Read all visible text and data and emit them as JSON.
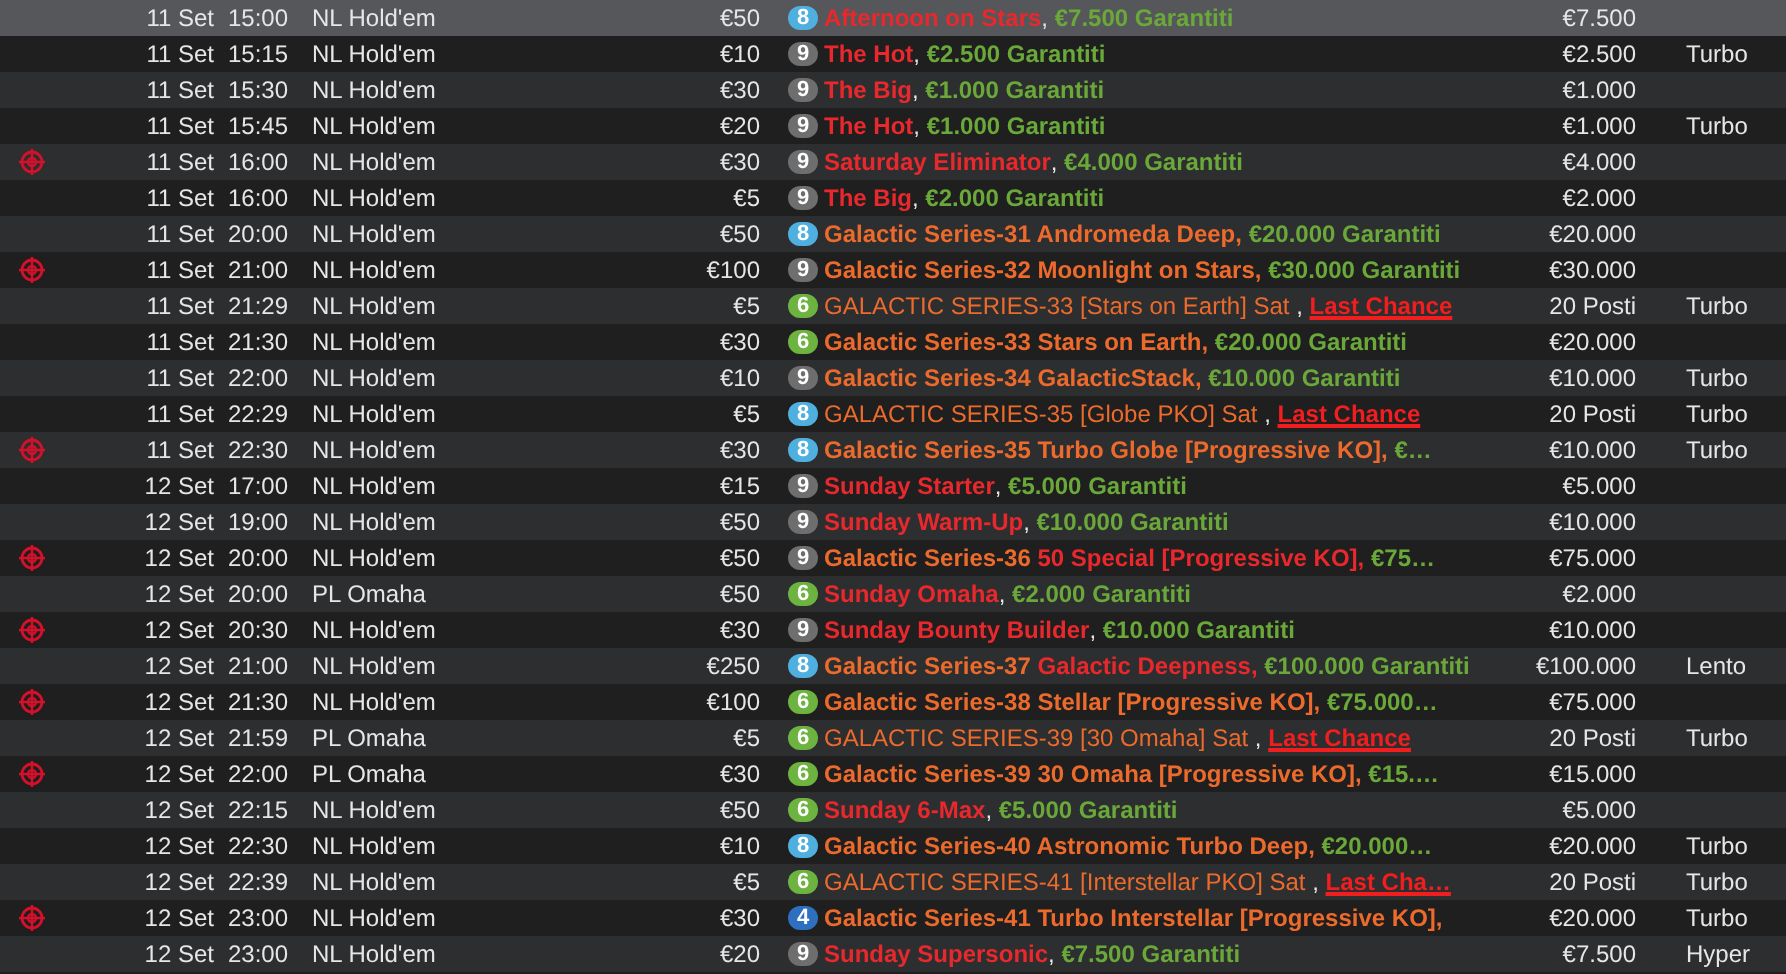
{
  "rows": [
    {
      "selected": true,
      "target": false,
      "date": "11 Set",
      "time": "15:00",
      "game": "NL Hold'em",
      "buyin": "€50",
      "badge": {
        "text": "8",
        "color": "#4fb0e0"
      },
      "name": [
        {
          "kind": "event",
          "text": "Afternoon on Stars"
        },
        {
          "kind": "sep",
          "text": ", "
        },
        {
          "kind": "prize",
          "text": "€7.500 Garantiti"
        }
      ],
      "guarantee": "€7.500"
    },
    {
      "selected": false,
      "target": false,
      "date": "11 Set",
      "time": "15:15",
      "game": "NL Hold'em",
      "buyin": "€10",
      "badge": {
        "text": "9",
        "color": "#6e6e6e"
      },
      "name": [
        {
          "kind": "event",
          "text": "The Hot"
        },
        {
          "kind": "sep",
          "text": ", "
        },
        {
          "kind": "prize",
          "text": "€2.500 Garantiti"
        }
      ],
      "guarantee": "€2.500",
      "speed": "Turbo"
    },
    {
      "selected": false,
      "target": false,
      "date": "11 Set",
      "time": "15:30",
      "game": "NL Hold'em",
      "buyin": "€30",
      "badge": {
        "text": "9",
        "color": "#6e6e6e"
      },
      "name": [
        {
          "kind": "event",
          "text": "The Big"
        },
        {
          "kind": "sep",
          "text": ", "
        },
        {
          "kind": "prize",
          "text": "€1.000 Garantiti"
        }
      ],
      "guarantee": "€1.000"
    },
    {
      "selected": false,
      "target": false,
      "date": "11 Set",
      "time": "15:45",
      "game": "NL Hold'em",
      "buyin": "€20",
      "badge": {
        "text": "9",
        "color": "#6e6e6e"
      },
      "name": [
        {
          "kind": "event",
          "text": "The Hot"
        },
        {
          "kind": "sep",
          "text": ", "
        },
        {
          "kind": "prize",
          "text": "€1.000 Garantiti"
        }
      ],
      "guarantee": "€1.000",
      "speed": "Turbo"
    },
    {
      "selected": false,
      "target": true,
      "date": "11 Set",
      "time": "16:00",
      "game": "NL Hold'em",
      "buyin": "€30",
      "badge": {
        "text": "9",
        "color": "#6e6e6e"
      },
      "name": [
        {
          "kind": "event",
          "text": "Saturday Eliminator"
        },
        {
          "kind": "sep",
          "text": ", "
        },
        {
          "kind": "prize",
          "text": "€4.000 Garantiti"
        }
      ],
      "guarantee": "€4.000"
    },
    {
      "selected": false,
      "target": false,
      "date": "11 Set",
      "time": "16:00",
      "game": "NL Hold'em",
      "buyin": "€5",
      "badge": {
        "text": "9",
        "color": "#6e6e6e"
      },
      "name": [
        {
          "kind": "event",
          "text": "The Big"
        },
        {
          "kind": "sep",
          "text": ", "
        },
        {
          "kind": "prize",
          "text": "€2.000 Garantiti"
        }
      ],
      "guarantee": "€2.000"
    },
    {
      "selected": false,
      "target": false,
      "date": "11 Set",
      "time": "20:00",
      "game": "NL Hold'em",
      "buyin": "€50",
      "badge": {
        "text": "8",
        "color": "#4fb0e0"
      },
      "name": [
        {
          "kind": "series",
          "text": "Galactic Series-31 Andromeda Deep,"
        },
        {
          "kind": "prize",
          "text": " €20.000 Garantiti"
        }
      ],
      "guarantee": "€20.000"
    },
    {
      "selected": false,
      "target": true,
      "date": "11 Set",
      "time": "21:00",
      "game": "NL Hold'em",
      "buyin": "€100",
      "badge": {
        "text": "9",
        "color": "#6e6e6e"
      },
      "name": [
        {
          "kind": "series",
          "text": "Galactic Series-32 Moonlight on Stars,"
        },
        {
          "kind": "prize",
          "text": " €30.000 Garantiti"
        }
      ],
      "guarantee": "€30.000"
    },
    {
      "selected": false,
      "target": false,
      "date": "11 Set",
      "time": "21:29",
      "game": "NL Hold'em",
      "buyin": "€5",
      "badge": {
        "text": "6",
        "color": "#6db33f"
      },
      "name": [
        {
          "kind": "sat",
          "text": "GALACTIC SERIES-33 [Stars on Earth] Sat"
        },
        {
          "kind": "sep",
          "text": " , "
        },
        {
          "kind": "chance",
          "text": "Last Chance"
        }
      ],
      "guarantee": "20 Posti",
      "speed": "Turbo"
    },
    {
      "selected": false,
      "target": false,
      "date": "11 Set",
      "time": "21:30",
      "game": "NL Hold'em",
      "buyin": "€30",
      "badge": {
        "text": "6",
        "color": "#6db33f"
      },
      "name": [
        {
          "kind": "series",
          "text": "Galactic Series-33 Stars on Earth,"
        },
        {
          "kind": "prize",
          "text": " €20.000 Garantiti"
        }
      ],
      "guarantee": "€20.000"
    },
    {
      "selected": false,
      "target": false,
      "date": "11 Set",
      "time": "22:00",
      "game": "NL Hold'em",
      "buyin": "€10",
      "badge": {
        "text": "9",
        "color": "#6e6e6e"
      },
      "name": [
        {
          "kind": "series",
          "text": "Galactic Series-34 GalacticStack,"
        },
        {
          "kind": "prize",
          "text": " €10.000 Garantiti"
        }
      ],
      "guarantee": "€10.000",
      "speed": "Turbo"
    },
    {
      "selected": false,
      "target": false,
      "date": "11 Set",
      "time": "22:29",
      "game": "NL Hold'em",
      "buyin": "€5",
      "badge": {
        "text": "8",
        "color": "#4fb0e0"
      },
      "name": [
        {
          "kind": "sat",
          "text": "GALACTIC SERIES-35 [Globe PKO] Sat"
        },
        {
          "kind": "sep",
          "text": " , "
        },
        {
          "kind": "chance",
          "text": "Last Chance"
        }
      ],
      "guarantee": "20 Posti",
      "speed": "Turbo"
    },
    {
      "selected": false,
      "target": true,
      "date": "11 Set",
      "time": "22:30",
      "game": "NL Hold'em",
      "buyin": "€30",
      "badge": {
        "text": "8",
        "color": "#4fb0e0"
      },
      "name": [
        {
          "kind": "series",
          "text": "Galactic Series-35 Turbo Globe [Progressive KO],"
        },
        {
          "kind": "prize",
          "text": " €…"
        }
      ],
      "guarantee": "€10.000",
      "speed": "Turbo"
    },
    {
      "selected": false,
      "target": false,
      "date": "12 Set",
      "time": "17:00",
      "game": "NL Hold'em",
      "buyin": "€15",
      "badge": {
        "text": "9",
        "color": "#6e6e6e"
      },
      "name": [
        {
          "kind": "event",
          "text": "Sunday Starter"
        },
        {
          "kind": "sep",
          "text": ", "
        },
        {
          "kind": "prize",
          "text": "€5.000 Garantiti"
        }
      ],
      "guarantee": "€5.000"
    },
    {
      "selected": false,
      "target": false,
      "date": "12 Set",
      "time": "19:00",
      "game": "NL Hold'em",
      "buyin": "€50",
      "badge": {
        "text": "9",
        "color": "#6e6e6e"
      },
      "name": [
        {
          "kind": "event",
          "text": "Sunday Warm-Up"
        },
        {
          "kind": "sep",
          "text": ", "
        },
        {
          "kind": "prize",
          "text": "€10.000 Garantiti"
        }
      ],
      "guarantee": "€10.000"
    },
    {
      "selected": false,
      "target": true,
      "date": "12 Set",
      "time": "20:00",
      "game": "NL Hold'em",
      "buyin": "€50",
      "badge": {
        "text": "9",
        "color": "#6e6e6e"
      },
      "name": [
        {
          "kind": "series",
          "text": "Galactic Series-36 "
        },
        {
          "kind": "event",
          "text": "50 Special [Progressive KO],"
        },
        {
          "kind": "prize",
          "text": " €75…"
        }
      ],
      "guarantee": "€75.000"
    },
    {
      "selected": false,
      "target": false,
      "date": "12 Set",
      "time": "20:00",
      "game": "PL Omaha",
      "buyin": "€50",
      "badge": {
        "text": "6",
        "color": "#6db33f"
      },
      "name": [
        {
          "kind": "event",
          "text": "Sunday Omaha"
        },
        {
          "kind": "sep",
          "text": ", "
        },
        {
          "kind": "prize",
          "text": "€2.000 Garantiti"
        }
      ],
      "guarantee": "€2.000"
    },
    {
      "selected": false,
      "target": true,
      "date": "12 Set",
      "time": "20:30",
      "game": "NL Hold'em",
      "buyin": "€30",
      "badge": {
        "text": "9",
        "color": "#6e6e6e"
      },
      "name": [
        {
          "kind": "event",
          "text": "Sunday Bounty Builder"
        },
        {
          "kind": "sep",
          "text": ", "
        },
        {
          "kind": "prize",
          "text": "€10.000 Garantiti"
        }
      ],
      "guarantee": "€10.000"
    },
    {
      "selected": false,
      "target": false,
      "date": "12 Set",
      "time": "21:00",
      "game": "NL Hold'em",
      "buyin": "€250",
      "badge": {
        "text": "8",
        "color": "#4fb0e0"
      },
      "name": [
        {
          "kind": "series",
          "text": "Galactic Series-37 "
        },
        {
          "kind": "event",
          "text": "Galactic Deepness,"
        },
        {
          "kind": "prize",
          "text": " €100.000 Garantiti"
        }
      ],
      "guarantee": "€100.000",
      "speed": "Lento"
    },
    {
      "selected": false,
      "target": true,
      "date": "12 Set",
      "time": "21:30",
      "game": "NL Hold'em",
      "buyin": "€100",
      "badge": {
        "text": "6",
        "color": "#6db33f"
      },
      "name": [
        {
          "kind": "series",
          "text": "Galactic Series-38 Stellar [Progressive KO],"
        },
        {
          "kind": "prize",
          "text": " €75.000…"
        }
      ],
      "guarantee": "€75.000"
    },
    {
      "selected": false,
      "target": false,
      "date": "12 Set",
      "time": "21:59",
      "game": "PL Omaha",
      "buyin": "€5",
      "badge": {
        "text": "6",
        "color": "#6db33f"
      },
      "name": [
        {
          "kind": "sat",
          "text": "GALACTIC SERIES-39 [30 Omaha] Sat"
        },
        {
          "kind": "sep",
          "text": " , "
        },
        {
          "kind": "chance",
          "text": "Last Chance"
        }
      ],
      "guarantee": "20 Posti",
      "speed": "Turbo"
    },
    {
      "selected": false,
      "target": true,
      "date": "12 Set",
      "time": "22:00",
      "game": "PL Omaha",
      "buyin": "€30",
      "badge": {
        "text": "6",
        "color": "#6db33f"
      },
      "name": [
        {
          "kind": "series",
          "text": "Galactic Series-39 30 Omaha [Progressive KO],"
        },
        {
          "kind": "prize",
          "text": " €15.…"
        }
      ],
      "guarantee": "€15.000"
    },
    {
      "selected": false,
      "target": false,
      "date": "12 Set",
      "time": "22:15",
      "game": "NL Hold'em",
      "buyin": "€50",
      "badge": {
        "text": "6",
        "color": "#6db33f"
      },
      "name": [
        {
          "kind": "event",
          "text": "Sunday 6-Max"
        },
        {
          "kind": "sep",
          "text": ", "
        },
        {
          "kind": "prize",
          "text": "€5.000 Garantiti"
        }
      ],
      "guarantee": "€5.000"
    },
    {
      "selected": false,
      "target": false,
      "date": "12 Set",
      "time": "22:30",
      "game": "NL Hold'em",
      "buyin": "€10",
      "badge": {
        "text": "8",
        "color": "#4fb0e0"
      },
      "name": [
        {
          "kind": "series",
          "text": "Galactic Series-40 Astronomic Turbo Deep,"
        },
        {
          "kind": "prize",
          "text": " €20.000…"
        }
      ],
      "guarantee": "€20.000",
      "speed": "Turbo"
    },
    {
      "selected": false,
      "target": false,
      "date": "12 Set",
      "time": "22:39",
      "game": "NL Hold'em",
      "buyin": "€5",
      "badge": {
        "text": "6",
        "color": "#6db33f"
      },
      "name": [
        {
          "kind": "sat",
          "text": "GALACTIC SERIES-41 [Interstellar PKO] Sat"
        },
        {
          "kind": "sep",
          "text": " , "
        },
        {
          "kind": "chance",
          "text": "Last Cha…"
        }
      ],
      "guarantee": "20 Posti",
      "speed": "Turbo"
    },
    {
      "selected": false,
      "target": true,
      "date": "12 Set",
      "time": "23:00",
      "game": "NL Hold'em",
      "buyin": "€30",
      "badge": {
        "text": "4",
        "color": "#2f6fc0"
      },
      "name": [
        {
          "kind": "series",
          "text": "Galactic Series-41 Turbo Interstellar [Progressive KO],"
        }
      ],
      "guarantee": "€20.000",
      "speed": "Turbo"
    },
    {
      "selected": false,
      "target": false,
      "date": "12 Set",
      "time": "23:00",
      "game": "NL Hold'em",
      "buyin": "€20",
      "badge": {
        "text": "9",
        "color": "#6e6e6e"
      },
      "name": [
        {
          "kind": "event",
          "text": "Sunday Supersonic"
        },
        {
          "kind": "sep",
          "text": ", "
        },
        {
          "kind": "prize",
          "text": "€7.500 Garantiti"
        }
      ],
      "guarantee": "€7.500",
      "speed": "Hyper"
    }
  ]
}
